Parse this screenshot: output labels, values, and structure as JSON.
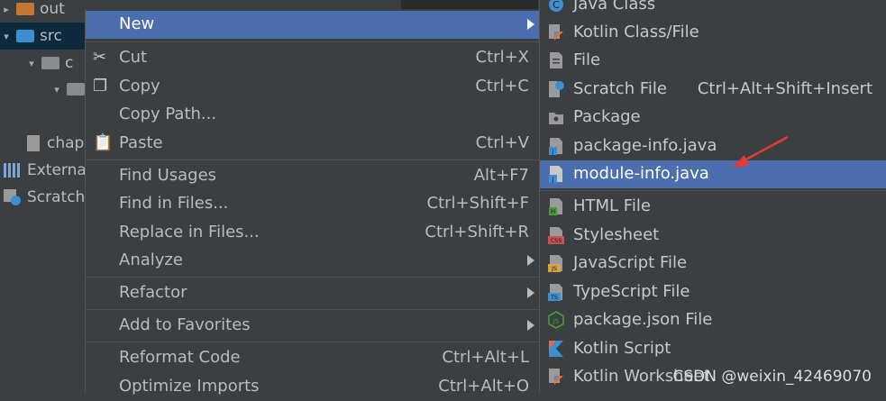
{
  "tree": {
    "items": [
      "out",
      "src",
      "c",
      "chap",
      "Externa",
      "Scratch"
    ]
  },
  "menu": {
    "items": [
      {
        "label": "New",
        "shortcut": ""
      },
      {
        "label": "Cut",
        "shortcut": "Ctrl+X"
      },
      {
        "label": "Copy",
        "shortcut": "Ctrl+C"
      },
      {
        "label": "Copy Path...",
        "shortcut": ""
      },
      {
        "label": "Paste",
        "shortcut": "Ctrl+V"
      },
      {
        "label": "Find Usages",
        "shortcut": "Alt+F7"
      },
      {
        "label": "Find in Files...",
        "shortcut": "Ctrl+Shift+F"
      },
      {
        "label": "Replace in Files...",
        "shortcut": "Ctrl+Shift+R"
      },
      {
        "label": "Analyze",
        "shortcut": ""
      },
      {
        "label": "Refactor",
        "shortcut": ""
      },
      {
        "label": "Add to Favorites",
        "shortcut": ""
      },
      {
        "label": "Reformat Code",
        "shortcut": "Ctrl+Alt+L"
      },
      {
        "label": "Optimize Imports",
        "shortcut": "Ctrl+Alt+O"
      }
    ]
  },
  "submenu": {
    "items": [
      {
        "label": "Java Class",
        "shortcut": ""
      },
      {
        "label": "Kotlin Class/File",
        "shortcut": ""
      },
      {
        "label": "File",
        "shortcut": ""
      },
      {
        "label": "Scratch File",
        "shortcut": "Ctrl+Alt+Shift+Insert"
      },
      {
        "label": "Package",
        "shortcut": ""
      },
      {
        "label": "package-info.java",
        "shortcut": ""
      },
      {
        "label": "module-info.java",
        "shortcut": ""
      },
      {
        "label": "HTML File",
        "shortcut": ""
      },
      {
        "label": "Stylesheet",
        "shortcut": ""
      },
      {
        "label": "JavaScript File",
        "shortcut": ""
      },
      {
        "label": "TypeScript File",
        "shortcut": ""
      },
      {
        "label": "package.json File",
        "shortcut": ""
      },
      {
        "label": "Kotlin Script",
        "shortcut": ""
      },
      {
        "label": "Kotlin Worksheet",
        "shortcut": ""
      }
    ]
  },
  "watermark": "CSDN @weixin_42469070",
  "colors": {
    "highlight": "#4b6eaf",
    "background": "#3c3f41",
    "annotation_arrow": "#e53935"
  }
}
